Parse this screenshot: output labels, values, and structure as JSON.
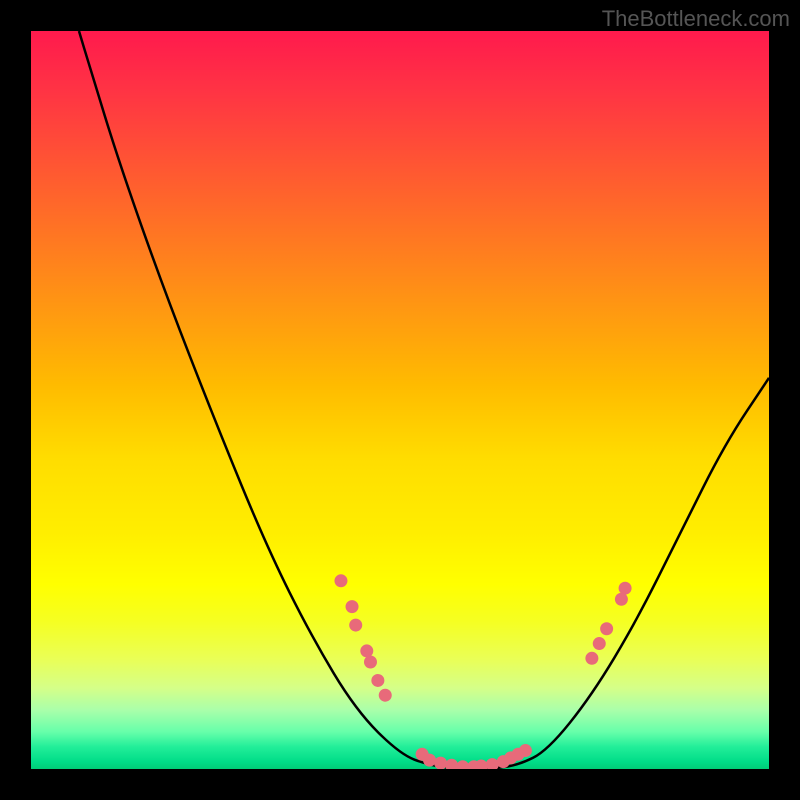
{
  "watermark": "TheBottleneck.com",
  "chart_data": {
    "type": "line",
    "title": "",
    "xlabel": "",
    "ylabel": "",
    "xlim": [
      0,
      100
    ],
    "ylim": [
      0,
      100
    ],
    "curve": {
      "name": "bottleneck-curve",
      "points": [
        {
          "x": 6.5,
          "y": 100
        },
        {
          "x": 8,
          "y": 95
        },
        {
          "x": 12,
          "y": 82
        },
        {
          "x": 18,
          "y": 65
        },
        {
          "x": 25,
          "y": 47
        },
        {
          "x": 32,
          "y": 30
        },
        {
          "x": 38,
          "y": 18
        },
        {
          "x": 44,
          "y": 8
        },
        {
          "x": 50,
          "y": 2
        },
        {
          "x": 54,
          "y": 0.5
        },
        {
          "x": 58,
          "y": 0
        },
        {
          "x": 62,
          "y": 0
        },
        {
          "x": 66,
          "y": 0.5
        },
        {
          "x": 70,
          "y": 2.5
        },
        {
          "x": 76,
          "y": 10
        },
        {
          "x": 82,
          "y": 20
        },
        {
          "x": 88,
          "y": 32
        },
        {
          "x": 94,
          "y": 44
        },
        {
          "x": 100,
          "y": 53
        }
      ]
    },
    "markers": [
      {
        "x": 42,
        "y": 25.5
      },
      {
        "x": 43.5,
        "y": 22
      },
      {
        "x": 44,
        "y": 19.5
      },
      {
        "x": 45.5,
        "y": 16
      },
      {
        "x": 46,
        "y": 14.5
      },
      {
        "x": 47,
        "y": 12
      },
      {
        "x": 48,
        "y": 10
      },
      {
        "x": 53,
        "y": 2
      },
      {
        "x": 54,
        "y": 1.2
      },
      {
        "x": 55.5,
        "y": 0.8
      },
      {
        "x": 57,
        "y": 0.5
      },
      {
        "x": 58.5,
        "y": 0.3
      },
      {
        "x": 60,
        "y": 0.3
      },
      {
        "x": 61,
        "y": 0.4
      },
      {
        "x": 62.5,
        "y": 0.6
      },
      {
        "x": 64,
        "y": 1
      },
      {
        "x": 65,
        "y": 1.5
      },
      {
        "x": 66,
        "y": 2
      },
      {
        "x": 67,
        "y": 2.5
      },
      {
        "x": 76,
        "y": 15
      },
      {
        "x": 77,
        "y": 17
      },
      {
        "x": 78,
        "y": 19
      },
      {
        "x": 80,
        "y": 23
      },
      {
        "x": 80.5,
        "y": 24.5
      }
    ],
    "gradient_colors": {
      "top": "#ff1a4d",
      "mid": "#ffee00",
      "bottom": "#00cc77"
    }
  }
}
